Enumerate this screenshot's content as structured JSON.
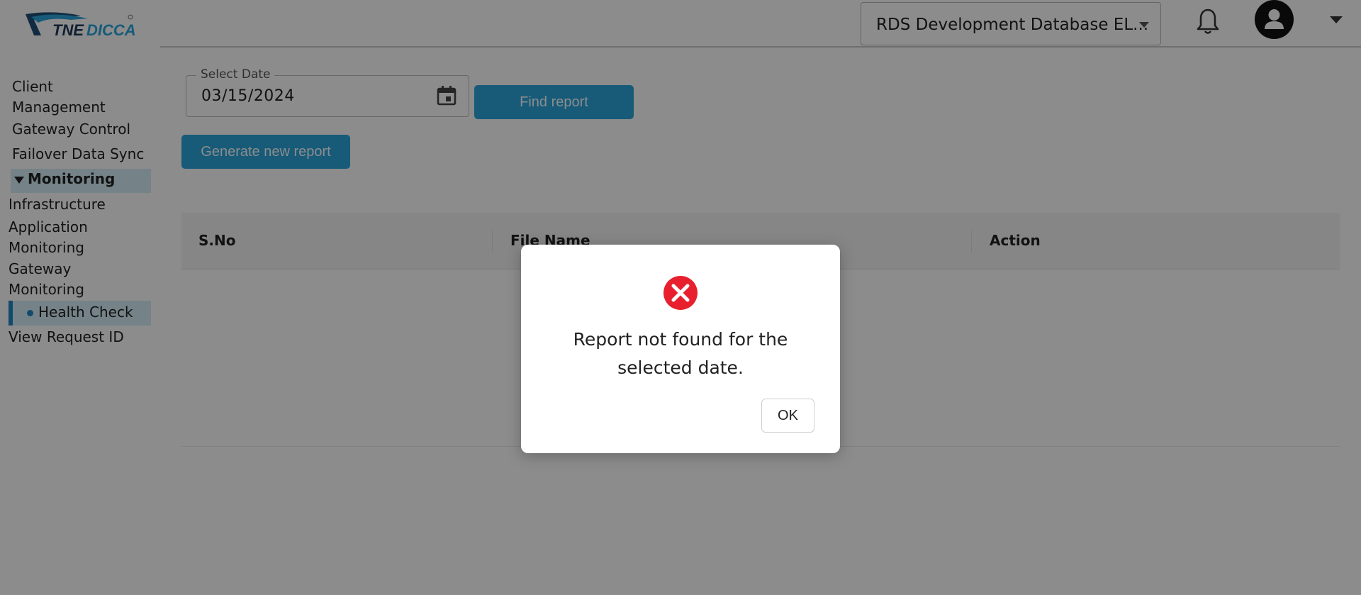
{
  "header": {
    "logo_text": "TNEDICCA",
    "database_select": "RDS Development Database EL...",
    "icons": {
      "bell": "bell-icon",
      "avatar": "user-avatar-icon",
      "menu": "chevron-down-icon"
    }
  },
  "sidebar": {
    "items": [
      {
        "label_line1": "Client",
        "label_line2": "Management"
      },
      {
        "label": "Gateway Control"
      },
      {
        "label": "Failover Data Sync"
      },
      {
        "label": "Monitoring"
      },
      {
        "label": "Infrastructure"
      },
      {
        "label_line1": "Application",
        "label_line2": "Monitoring"
      },
      {
        "label_line1": "Gateway",
        "label_line2": "Monitoring"
      },
      {
        "label": "Health Check"
      },
      {
        "label": "View Request ID"
      }
    ]
  },
  "main": {
    "date_field": {
      "label": "Select Date",
      "value": "03/15/2024"
    },
    "find_button": "Find report",
    "generate_button": "Generate new report",
    "table": {
      "columns": [
        "S.No",
        "File Name",
        "Action"
      ],
      "rows": []
    }
  },
  "modal": {
    "icon": "error-icon",
    "message": "Report not found for the selected date.",
    "ok_label": "OK"
  },
  "colors": {
    "primary": "#2aa6dc",
    "error": "#e8202e",
    "active_bg": "#d6eef8"
  }
}
